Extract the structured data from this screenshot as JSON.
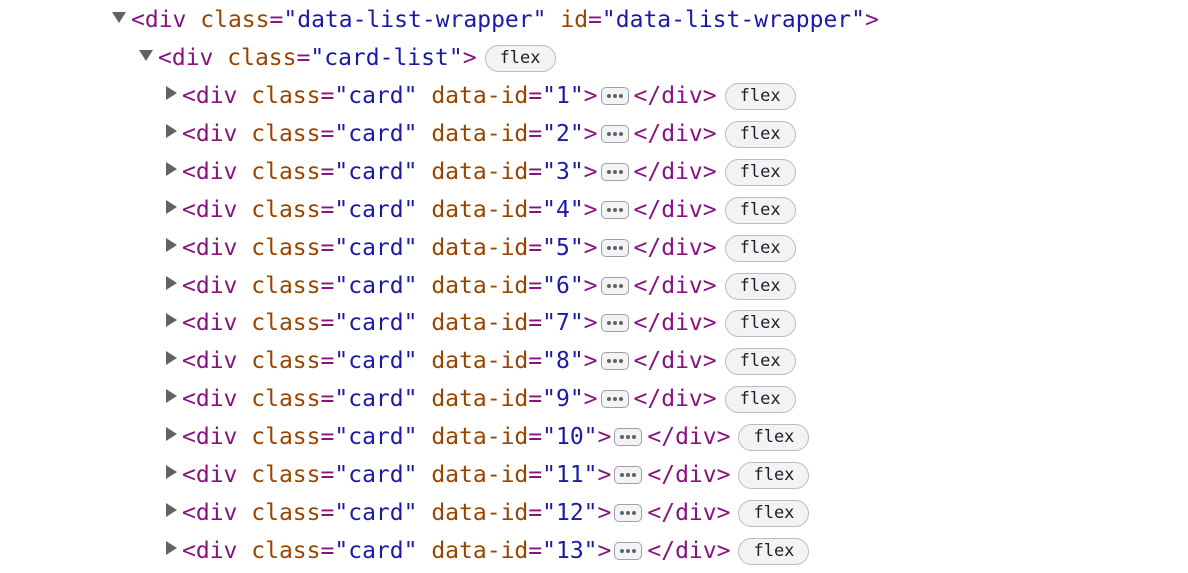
{
  "wrapper": {
    "tag_open": "<",
    "tag_name": "div",
    "attrs": [
      {
        "name": "class",
        "value": "\"data-list-wrapper\""
      },
      {
        "name": "id",
        "value": "\"data-list-wrapper\""
      }
    ],
    "tag_close": ">",
    "expanded": true
  },
  "card_list": {
    "tag_open": "<",
    "tag_name": "div",
    "attr_name": "class",
    "attr_value": "\"card-list\"",
    "tag_close": ">",
    "badge": "flex",
    "expanded": true
  },
  "cards": [
    {
      "id": "\"1\""
    },
    {
      "id": "\"2\""
    },
    {
      "id": "\"3\""
    },
    {
      "id": "\"4\""
    },
    {
      "id": "\"5\""
    },
    {
      "id": "\"6\""
    },
    {
      "id": "\"7\""
    },
    {
      "id": "\"8\""
    },
    {
      "id": "\"9\""
    },
    {
      "id": "\"10\""
    },
    {
      "id": "\"11\""
    },
    {
      "id": "\"12\""
    },
    {
      "id": "\"13\""
    }
  ],
  "card_common": {
    "tag_open": "<",
    "tag_name": "div",
    "class_attr": "class",
    "class_value": "\"card\"",
    "data_attr": "data-id",
    "tag_close": ">",
    "closing_tag": "</div>",
    "badge": "flex",
    "collapsed_icon": "ellipsis-icon"
  },
  "colors": {
    "tag": "#881280",
    "attr_name": "#994500",
    "attr_value": "#1a1aa6",
    "triangle": "#5f6368",
    "badge_bg": "#f1f3f4"
  }
}
